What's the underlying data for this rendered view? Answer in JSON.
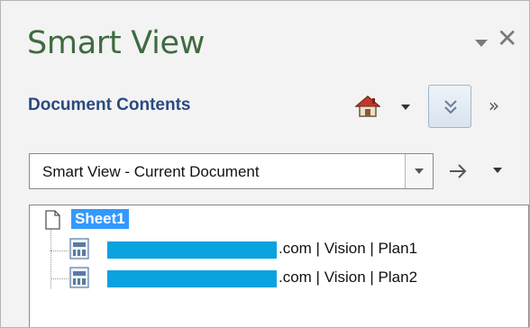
{
  "pane": {
    "title": "Smart View",
    "section_title": "Document Contents"
  },
  "source_combo": {
    "value": "Smart View - Current Document"
  },
  "tree": {
    "root_label": "Sheet1",
    "connections": [
      {
        "label": ".com | Vision | Plan1"
      },
      {
        "label": ".com | Vision | Plan2"
      }
    ]
  },
  "colors": {
    "title_green": "#3f6b3f",
    "section_blue": "#2a4a80",
    "selection_blue": "#3399ff",
    "redaction": "#0aa2df"
  },
  "icons": [
    "chevron-down-icon",
    "close-icon",
    "home-icon",
    "double-chevron-down-icon",
    "double-chevron-right-icon",
    "arrow-right-icon",
    "document-icon",
    "connection-icon"
  ]
}
